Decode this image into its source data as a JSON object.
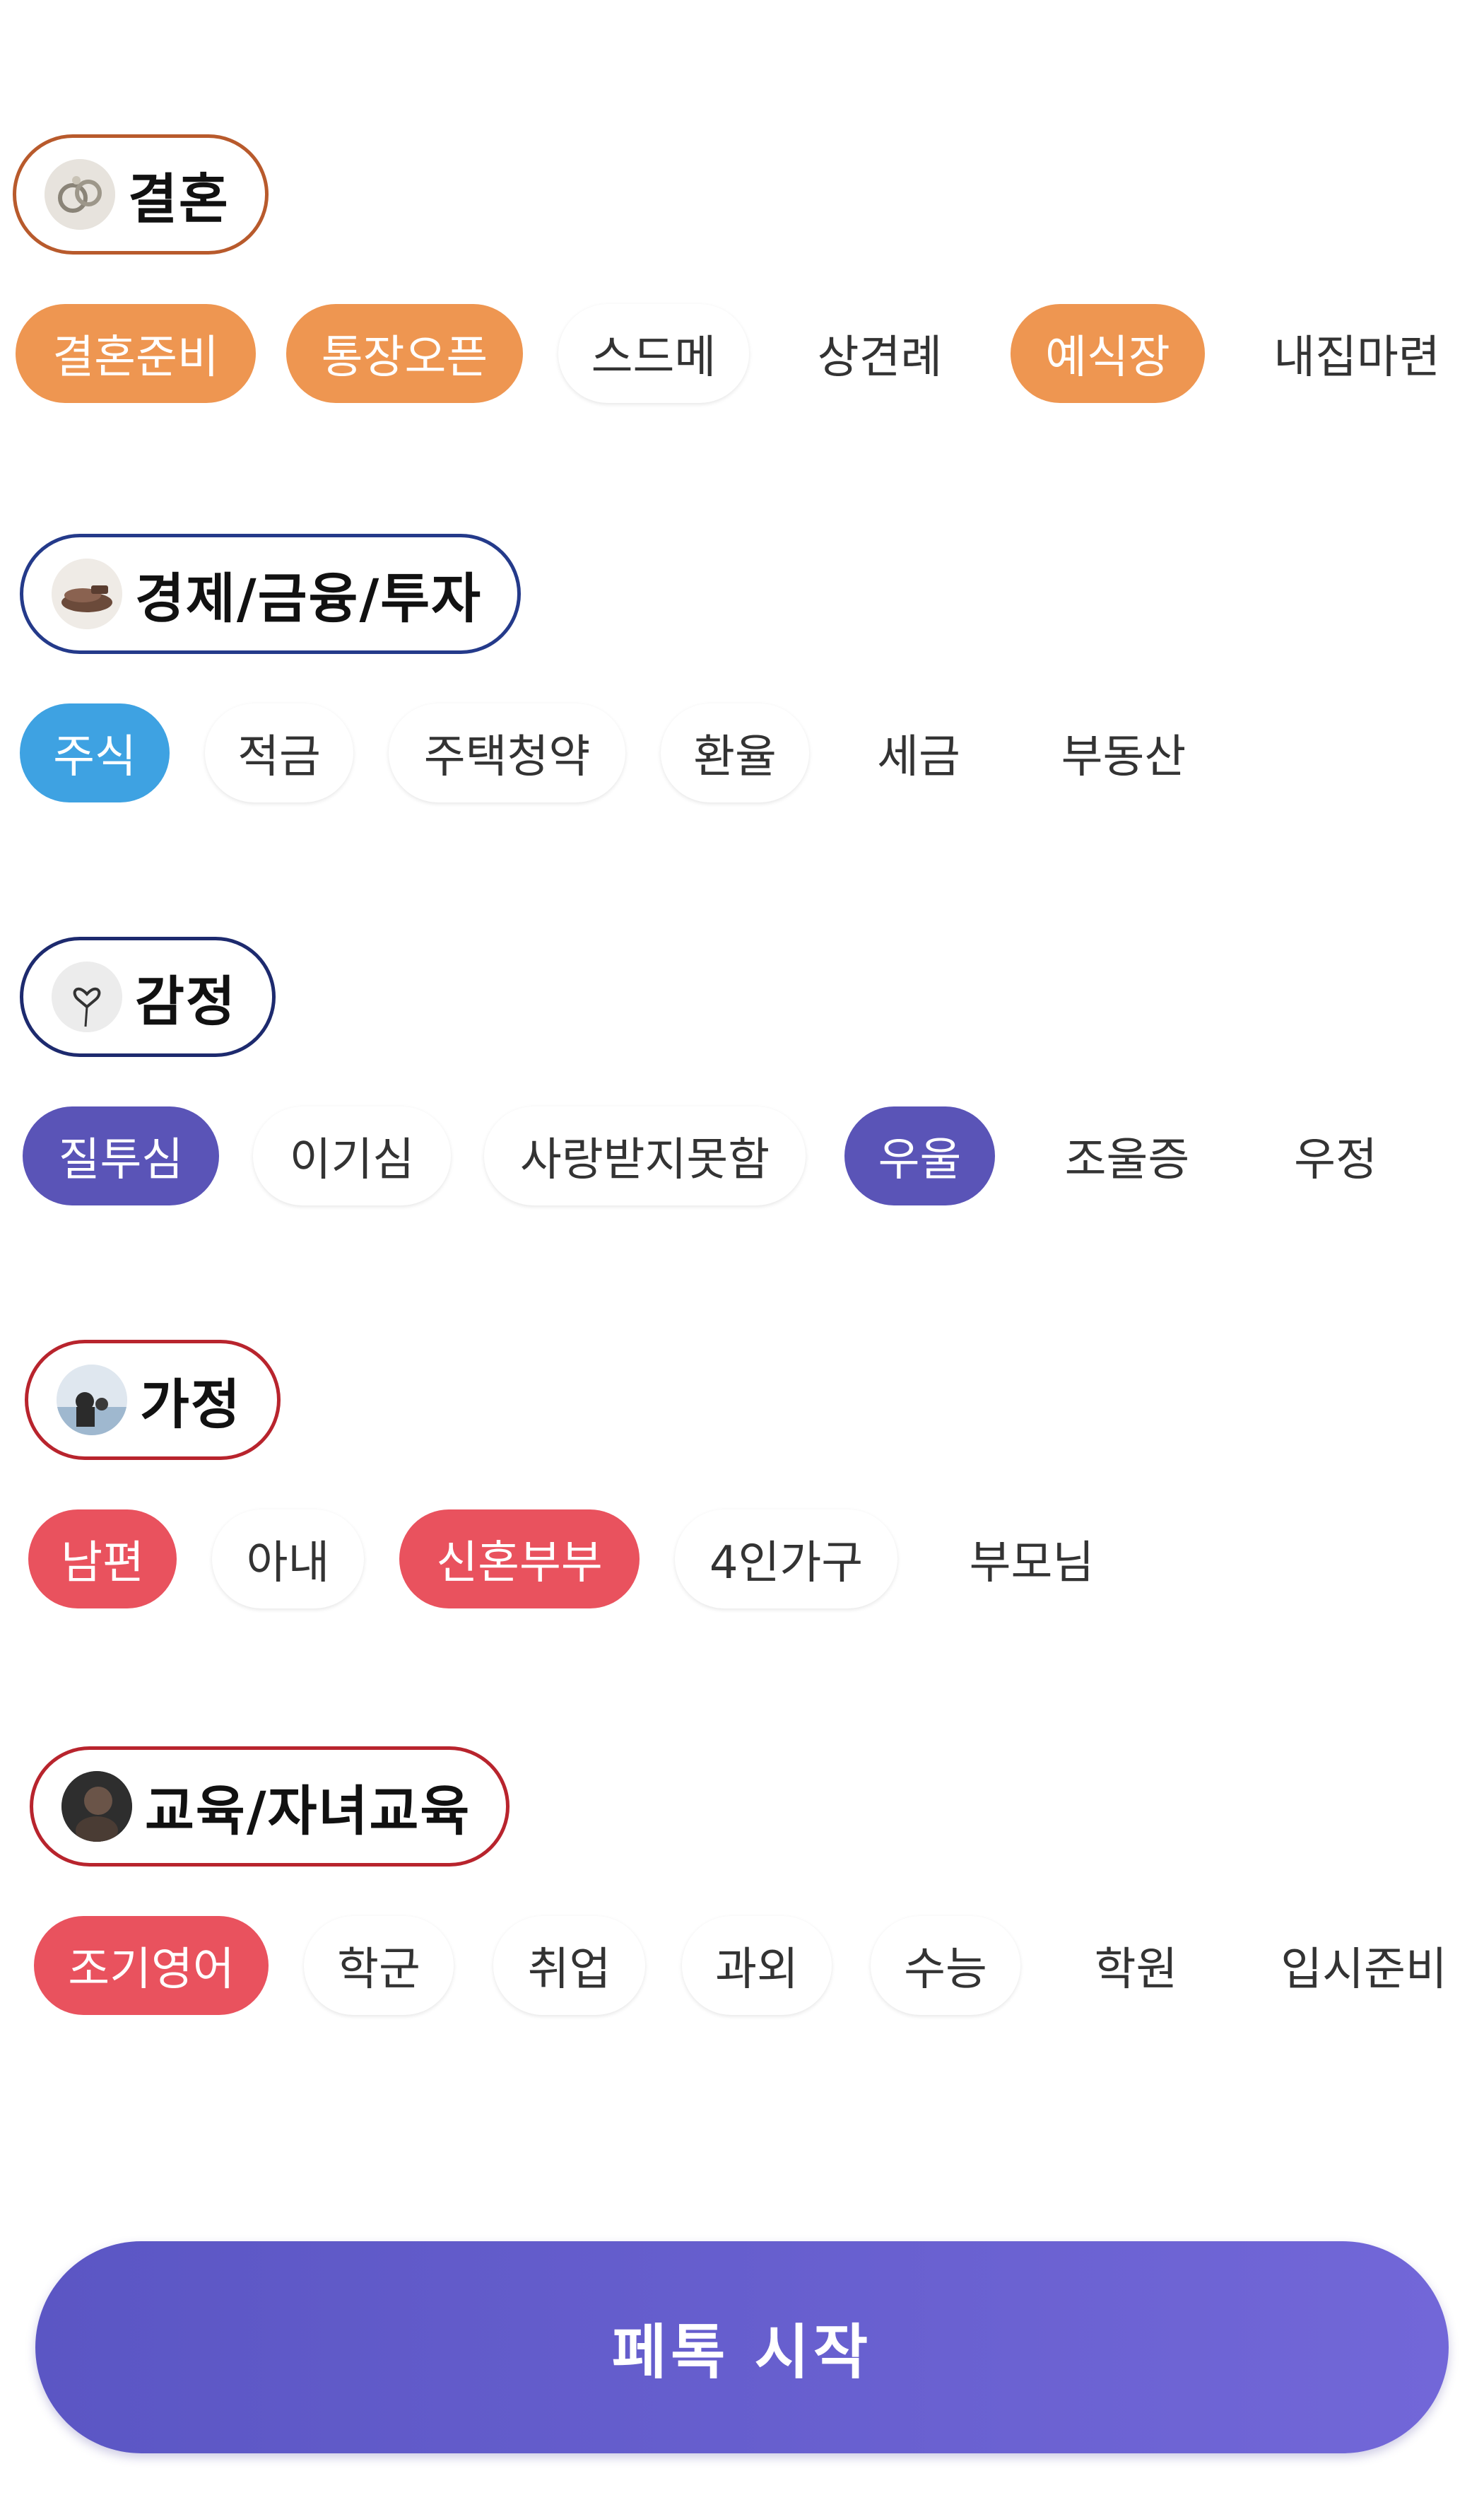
{
  "colors": {
    "marriage": "#ee9651",
    "finance": "#3ea2e2",
    "emotion": "#5a54b7",
    "family": "#e9525e",
    "education": "#e9525e",
    "border_marriage": "#b85a2c",
    "border_finance": "#243a8a",
    "border_emotion": "#1d2a6e",
    "border_family": "#b8242d",
    "border_education": "#b8242d"
  },
  "categories": [
    {
      "label": "결혼",
      "icon": "rings-icon",
      "tags": [
        {
          "label": "결혼준비",
          "selected": true
        },
        {
          "label": "통장오픈",
          "selected": true
        },
        {
          "label": "스드메",
          "selected": false
        },
        {
          "label": "상견례",
          "selected": false
        },
        {
          "label": "예식장",
          "selected": true
        },
        {
          "label": "내집마련",
          "selected": false
        }
      ]
    },
    {
      "label": "경제/금융/투자",
      "icon": "money-icon",
      "tags": [
        {
          "label": "주식",
          "selected": true
        },
        {
          "label": "적금",
          "selected": false
        },
        {
          "label": "주택청약",
          "selected": false
        },
        {
          "label": "환율",
          "selected": false
        },
        {
          "label": "세금",
          "selected": false
        },
        {
          "label": "부동산",
          "selected": false
        }
      ]
    },
    {
      "label": "감정",
      "icon": "heart-balloon-icon",
      "tags": [
        {
          "label": "질투심",
          "selected": true
        },
        {
          "label": "이기심",
          "selected": false
        },
        {
          "label": "사랑받지못함",
          "selected": false
        },
        {
          "label": "우울",
          "selected": true
        },
        {
          "label": "조울증",
          "selected": false
        },
        {
          "label": "우정",
          "selected": false
        }
      ]
    },
    {
      "label": "가정",
      "icon": "family-photo-icon",
      "tags": [
        {
          "label": "남편",
          "selected": true
        },
        {
          "label": "아내",
          "selected": false
        },
        {
          "label": "신혼부부",
          "selected": true
        },
        {
          "label": "4인가구",
          "selected": false
        },
        {
          "label": "부모님",
          "selected": false
        }
      ]
    },
    {
      "label": "교육/자녀교육",
      "icon": "child-photo-icon",
      "tags": [
        {
          "label": "조기영어",
          "selected": true
        },
        {
          "label": "학군",
          "selected": false
        },
        {
          "label": "취업",
          "selected": false
        },
        {
          "label": "과외",
          "selected": false
        },
        {
          "label": "수능",
          "selected": false
        },
        {
          "label": "학원",
          "selected": false
        },
        {
          "label": "입시준비",
          "selected": false
        }
      ]
    }
  ],
  "start_button": {
    "label": "페톡 시작"
  }
}
